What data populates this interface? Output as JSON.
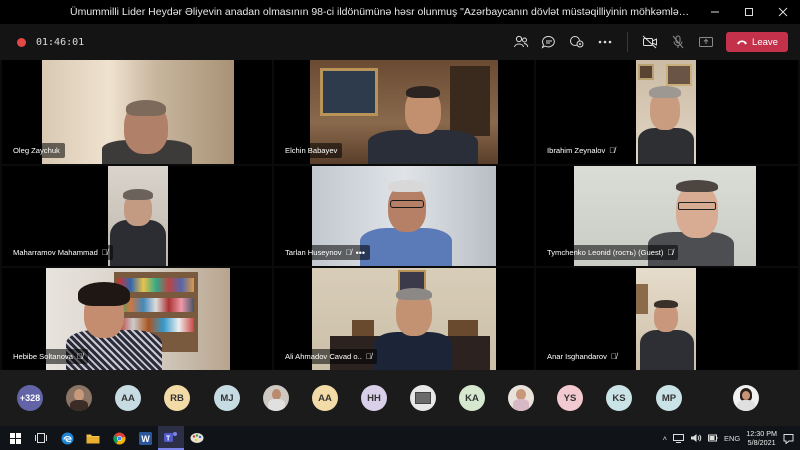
{
  "window": {
    "title": "Ümummilli Lider Heydər Əliyevin anadan olmasının 98-ci ildönümünə həsr olunmuş \"Azərbaycanın dövlət müstəqilliyinin möhkəmləndirilməsi və inkişafında Heydər Əliyevin ...",
    "minimize_icon": "minimize-icon",
    "maximize_icon": "maximize-icon",
    "close_icon": "close-icon"
  },
  "toolbar": {
    "recording_color": "#e34848",
    "timer": "01:46:01",
    "icons": [
      "people-icon",
      "chat-icon",
      "raise-hand-icon",
      "more-options-icon",
      "camera-off-icon",
      "mic-muted-icon",
      "share-tray-icon"
    ],
    "leave_label": "Leave",
    "leave_color": "#c4314b"
  },
  "participants": [
    {
      "name": "Oleg Zaychuk",
      "muted": false,
      "more": false
    },
    {
      "name": "Elchin Babayev",
      "muted": false,
      "more": false
    },
    {
      "name": "Ibrahim Zeynalov",
      "muted": true,
      "more": false
    },
    {
      "name": "Maharramov Mahammad",
      "muted": true,
      "more": false
    },
    {
      "name": "Tarlan Huseynov",
      "muted": true,
      "more": true
    },
    {
      "name": "Tymchenko Leonid (гость) (Guest)",
      "muted": true,
      "more": false
    },
    {
      "name": "Hebibe Soltanova",
      "muted": true,
      "more": false
    },
    {
      "name": "Ali Ahmadov Cavad o..",
      "muted": true,
      "more": false
    },
    {
      "name": "Anar Isghandarov",
      "muted": true,
      "more": false
    }
  ],
  "attendees": {
    "overflow_count": "+328",
    "avatars": [
      {
        "initials": "",
        "type": "photo"
      },
      {
        "initials": "AA",
        "color": "#c7dbe3"
      },
      {
        "initials": "RB",
        "color": "#f3dba8"
      },
      {
        "initials": "MJ",
        "color": "#c7dbe3"
      },
      {
        "initials": "",
        "type": "photo"
      },
      {
        "initials": "AA",
        "color": "#f3dba8"
      },
      {
        "initials": "HH",
        "color": "#d9cfe8"
      },
      {
        "initials": "",
        "type": "photo"
      },
      {
        "initials": "KA",
        "color": "#d6e8cf"
      },
      {
        "initials": "",
        "type": "photo"
      },
      {
        "initials": "YS",
        "color": "#f2c9cf"
      },
      {
        "initials": "KS",
        "color": "#c9e3e6"
      },
      {
        "initials": "MP",
        "color": "#c9e3e6"
      },
      {
        "initials": "",
        "type": "photo"
      }
    ]
  },
  "taskbar": {
    "apps": [
      "windows-start-icon",
      "task-view-icon",
      "edge-icon",
      "file-explorer-icon",
      "chrome-icon",
      "word-icon",
      "teams-icon",
      "paint-icon"
    ],
    "language": "ENG",
    "time": "12:30 PM",
    "date": "5/8/2021"
  }
}
